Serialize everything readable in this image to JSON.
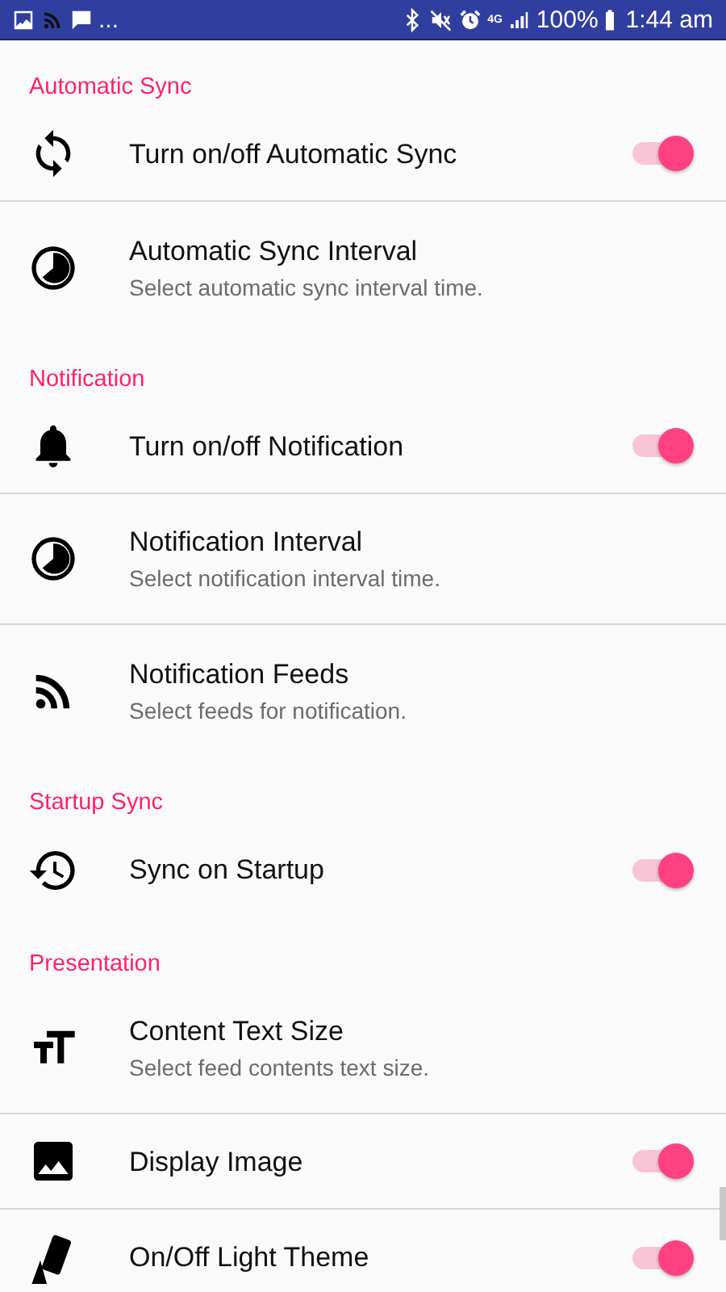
{
  "status_bar": {
    "more": "...",
    "network": "4G",
    "battery": "100%",
    "time": "1:44 am"
  },
  "sections": [
    {
      "title": "Automatic Sync",
      "items": [
        {
          "title": "Turn on/off Automatic Sync",
          "kind": "switch",
          "on": true
        },
        {
          "title": "Automatic Sync Interval",
          "subtitle": "Select automatic sync interval time.",
          "kind": "plain"
        }
      ]
    },
    {
      "title": "Notification",
      "items": [
        {
          "title": "Turn on/off Notification",
          "kind": "switch",
          "on": true
        },
        {
          "title": "Notification Interval",
          "subtitle": "Select notification interval time.",
          "kind": "plain"
        },
        {
          "title": "Notification Feeds",
          "subtitle": "Select feeds for notification.",
          "kind": "plain"
        }
      ]
    },
    {
      "title": "Startup Sync",
      "items": [
        {
          "title": "Sync on Startup",
          "kind": "switch",
          "on": true
        }
      ]
    },
    {
      "title": "Presentation",
      "items": [
        {
          "title": "Content Text Size",
          "subtitle": "Select feed contents text size.",
          "kind": "plain"
        },
        {
          "title": "Display Image",
          "kind": "switch",
          "on": true
        },
        {
          "title": "On/Off Light Theme",
          "kind": "switch",
          "on": true
        }
      ]
    }
  ]
}
